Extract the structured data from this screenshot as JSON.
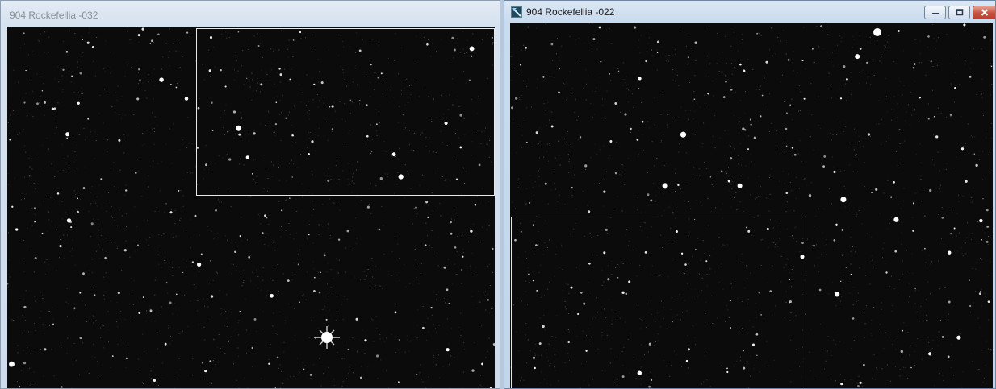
{
  "windows": {
    "left": {
      "title": "904 Rockefellia -032"
    },
    "right": {
      "title": "904 Rockefellia -022",
      "controls": {
        "minimize_icon": "minimize-icon",
        "maximize_icon": "maximize-icon",
        "close_icon": "close-icon"
      }
    }
  },
  "colors": {
    "sky_background": "#0b0b0b",
    "star": "#ffffff",
    "selection_rect": "#e8e8e8",
    "close_button": "#c7523f"
  }
}
